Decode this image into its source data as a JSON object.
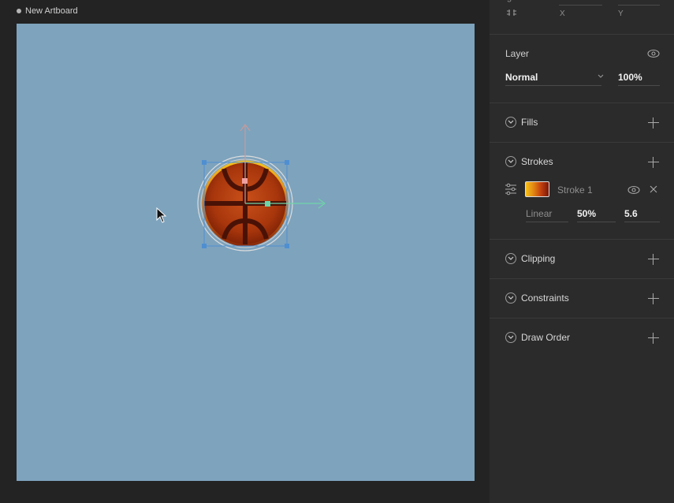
{
  "canvas": {
    "artboard_title": "New Artboard",
    "artboard_color": "#7ea3bd"
  },
  "panel": {
    "position": {
      "x_label": "X",
      "y_label": "Y",
      "truncated_label": "g"
    },
    "layer": {
      "title": "Layer",
      "blend_mode": "Normal",
      "opacity": "100%"
    },
    "sections": {
      "fills": "Fills",
      "strokes": "Strokes",
      "clipping": "Clipping",
      "constraints": "Constraints",
      "draw_order": "Draw Order"
    },
    "stroke": {
      "name": "Stroke 1",
      "type": "Linear",
      "position": "50%",
      "width": "5.6"
    }
  },
  "icons": [
    "link-icon",
    "eye-icon",
    "chevron-down-icon",
    "plus-icon",
    "sliders-icon",
    "close-icon",
    "cursor-icon"
  ]
}
